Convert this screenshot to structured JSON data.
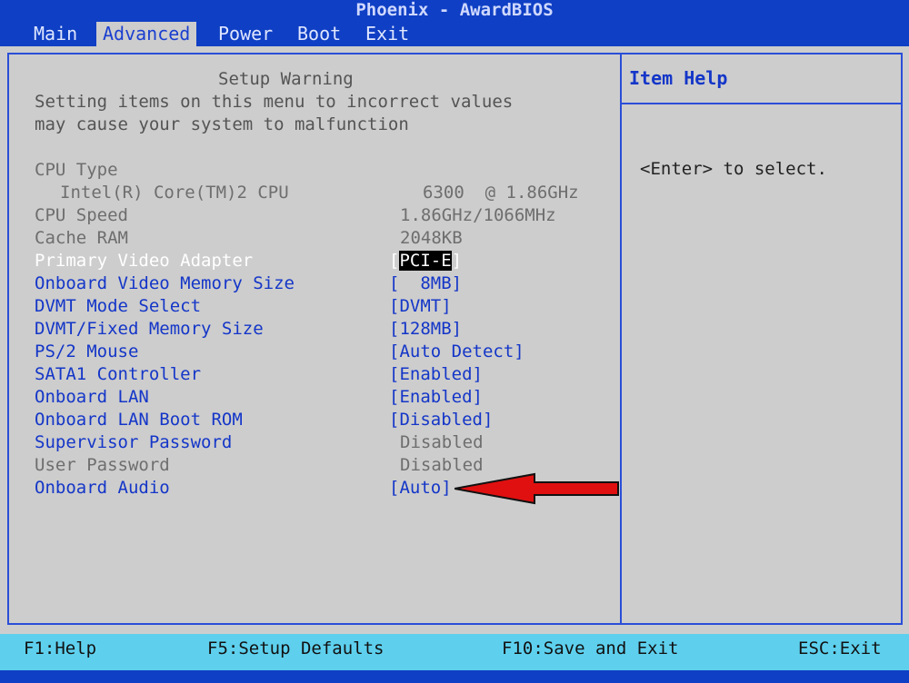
{
  "title": "Phoenix - AwardBIOS",
  "menu": [
    {
      "label": "Main"
    },
    {
      "label": "Advanced"
    },
    {
      "label": "Power"
    },
    {
      "label": "Boot"
    },
    {
      "label": "Exit"
    }
  ],
  "active_menu": "Advanced",
  "warning": {
    "title": "Setup Warning",
    "line1": "Setting items on this menu to incorrect values",
    "line2": "may cause your system to malfunction"
  },
  "info": {
    "cpu_type_label": "CPU Type",
    "cpu_name": "Intel(R) Core(TM)2 CPU",
    "cpu_model": "6300  @ 1.86GHz",
    "cpu_speed_label": "CPU Speed",
    "cpu_speed_value": "1.86GHz/1066MHz",
    "cache_label": "Cache RAM",
    "cache_value": "2048KB"
  },
  "settings": [
    {
      "label": "Primary Video Adapter",
      "value_prefix": "[",
      "value": "PCI-E",
      "value_suffix": "]",
      "selected": true
    },
    {
      "label": "Onboard Video Memory Size",
      "value": "[  8MB]"
    },
    {
      "label": "DVMT Mode Select",
      "value": "[DVMT]"
    },
    {
      "label": "DVMT/Fixed Memory Size",
      "value": "[128MB]"
    },
    {
      "label": "PS/2 Mouse",
      "value": "[Auto Detect]"
    },
    {
      "label": "SATA1 Controller",
      "value": "[Enabled]"
    },
    {
      "label": "Onboard LAN",
      "value": "[Enabled]"
    },
    {
      "label": "Onboard LAN Boot ROM",
      "value": "[Disabled]"
    },
    {
      "label": "Supervisor Password",
      "value": "Disabled"
    },
    {
      "label": "User Password",
      "value": "Disabled"
    },
    {
      "label": "Onboard Audio",
      "value": "[Auto]"
    }
  ],
  "help": {
    "title": "Item Help",
    "text": "<Enter> to select."
  },
  "footer": {
    "f1": "F1:Help",
    "f5": "F5:Setup Defaults",
    "f10": "F10:Save and Exit",
    "esc": "ESC:Exit"
  },
  "colors": {
    "bar_blue": "#0f3fc4",
    "setting_blue": "#1436c8",
    "footer_cyan": "#5ed0ee",
    "arrow_red": "#e01010"
  }
}
